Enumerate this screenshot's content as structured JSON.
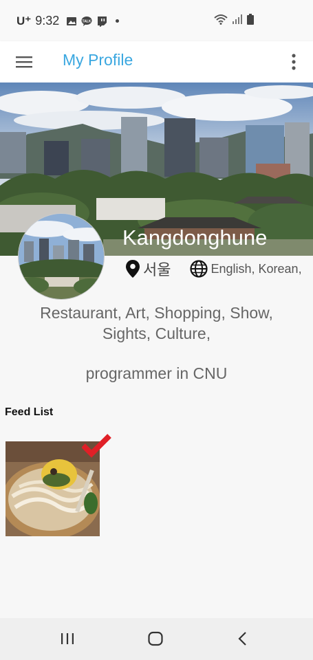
{
  "status": {
    "carrier": "U⁺",
    "time": "9:32",
    "icons": [
      "gallery-icon",
      "talk-icon",
      "twitch-icon",
      "dot-icon",
      "wifi-icon",
      "signal-icon",
      "battery-icon"
    ]
  },
  "app_bar": {
    "title": "My Profile",
    "title_color": "#3aa7e0",
    "menu_icon": "hamburger-menu-icon",
    "more_icon": "more-vertical-icon"
  },
  "profile": {
    "username": "Kangdonghune",
    "location": "서울",
    "languages": "English,  Korean,",
    "interests_line1": "Restaurant,  Art,  Shopping,  Show,",
    "interests_line2": "Sights,  Culture,",
    "bio": "programmer in  CNU"
  },
  "feed": {
    "label": "Feed List",
    "items": [
      {
        "icon": "noodle-photo",
        "checked": true
      }
    ]
  },
  "nav": {
    "buttons": [
      "recent-apps-icon",
      "home-icon",
      "back-icon"
    ]
  }
}
